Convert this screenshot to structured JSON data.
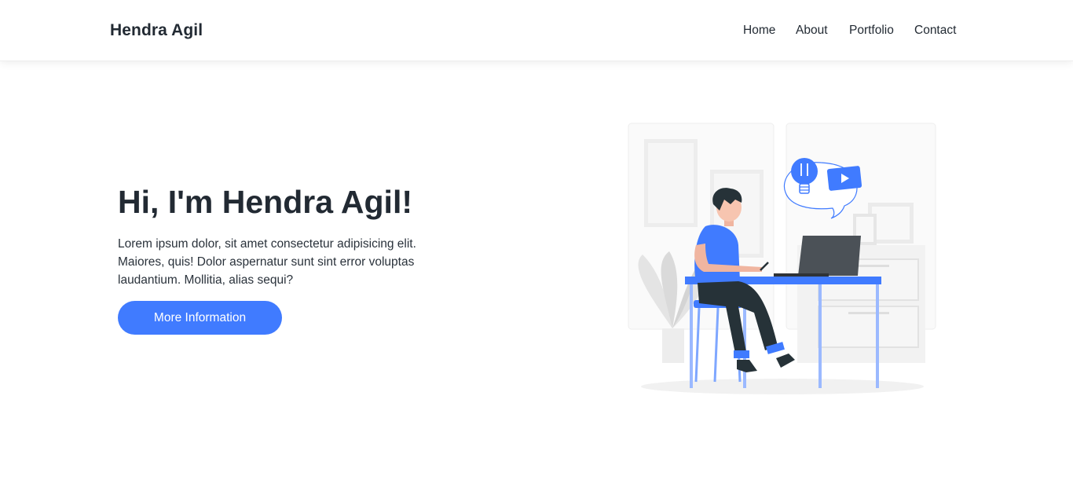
{
  "navbar": {
    "brand": "Hendra Agil",
    "links": [
      {
        "label": "Home"
      },
      {
        "label": "About"
      },
      {
        "label": "Portfolio"
      },
      {
        "label": "Contact"
      }
    ]
  },
  "hero": {
    "title": "Hi, I'm Hendra Agil!",
    "description": "Lorem ipsum dolor, sit amet consectetur adipisicing elit. Maiores, quis! Dolor aspernatur sunt sint error voluptas laudantium. Mollitia, alias sequi?",
    "button_label": "More Information",
    "illustration_icon": "person-working-at-laptop-illustration"
  },
  "colors": {
    "accent": "#407bff",
    "text": "#222a33",
    "background": "#ffffff"
  }
}
